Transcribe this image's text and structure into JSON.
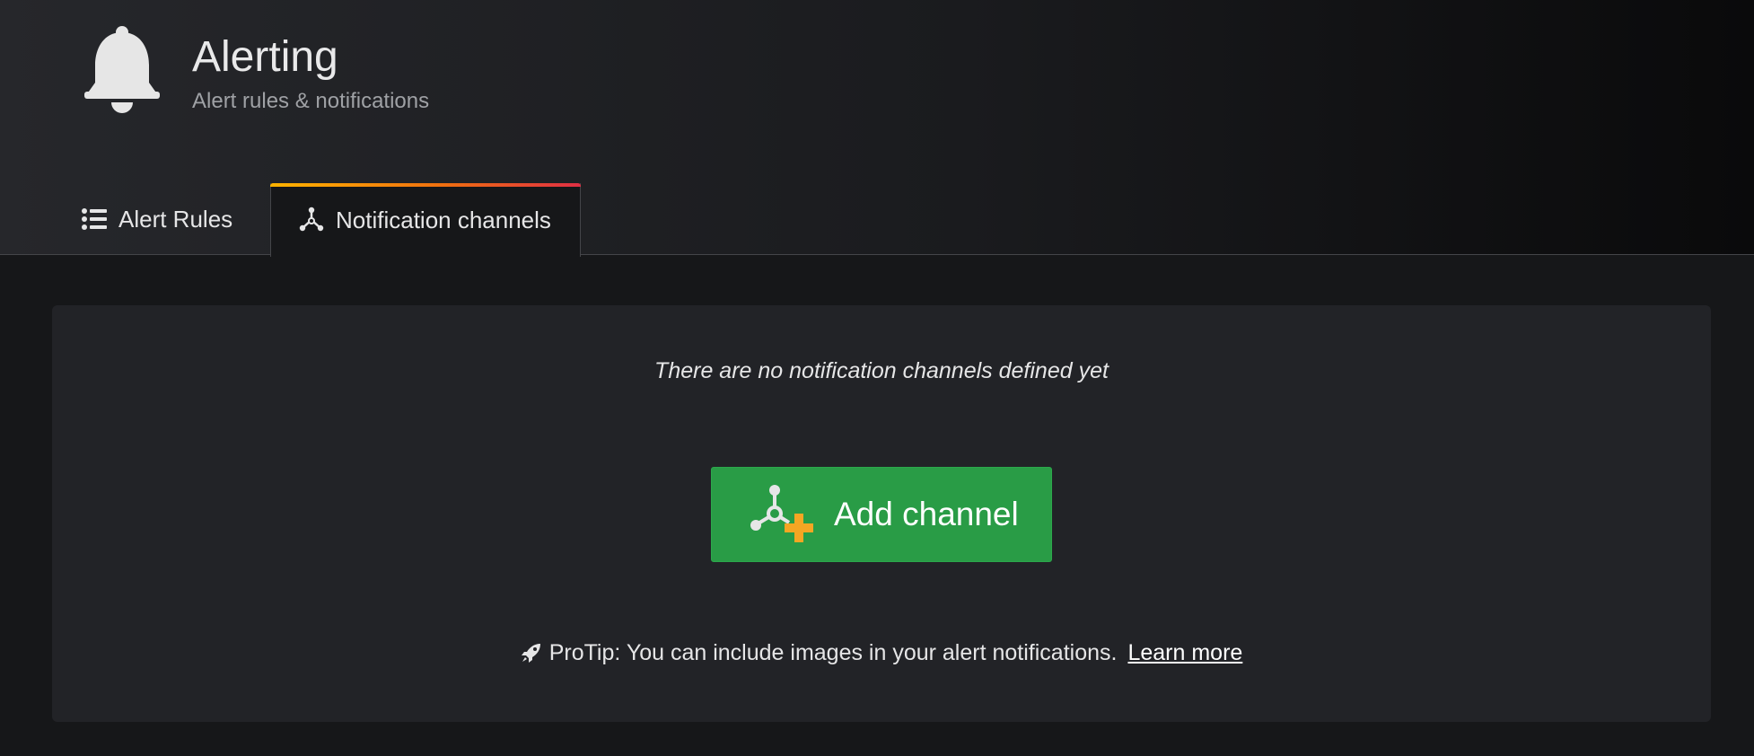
{
  "header": {
    "icon": "bell-icon",
    "title": "Alerting",
    "subtitle": "Alert rules & notifications"
  },
  "tabs": [
    {
      "label": "Alert Rules",
      "icon": "list-icon",
      "active": false
    },
    {
      "label": "Notification channels",
      "icon": "channels-icon",
      "active": true
    }
  ],
  "empty_state": {
    "message": "There are no notification channels defined yet",
    "button_label": "Add channel",
    "button_icon": "add-channel-icon",
    "protip_icon": "rocket-icon",
    "protip_text": "ProTip: You can include images in your alert notifications.",
    "learn_more_label": "Learn more"
  },
  "colors": {
    "background": "#161719",
    "panel": "#222327",
    "button_green": "#299c46",
    "plus_orange": "#f5a623",
    "tab_accent_start": "#ffb400",
    "tab_accent_end": "#e02f44"
  }
}
